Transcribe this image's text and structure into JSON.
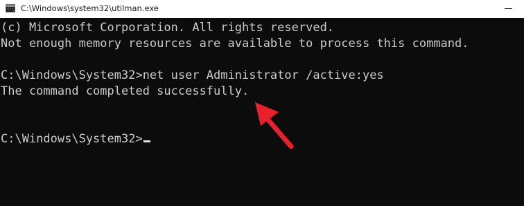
{
  "window": {
    "title": "C:\\Windows\\system32\\utilman.exe",
    "app_icon": "cmd-console-icon"
  },
  "console": {
    "lines": [
      "(c) Microsoft Corporation. All rights reserved.",
      "Not enough memory resources are available to process this command.",
      "",
      "C:\\Windows\\System32>net user Administrator /active:yes",
      "The command completed successfully.",
      "",
      "",
      "C:\\Windows\\System32>"
    ],
    "text_color": "#cccccc",
    "background": "#0c0c0c"
  },
  "annotation": {
    "icon": "red-arrow-icon",
    "color": "#e8202a"
  }
}
